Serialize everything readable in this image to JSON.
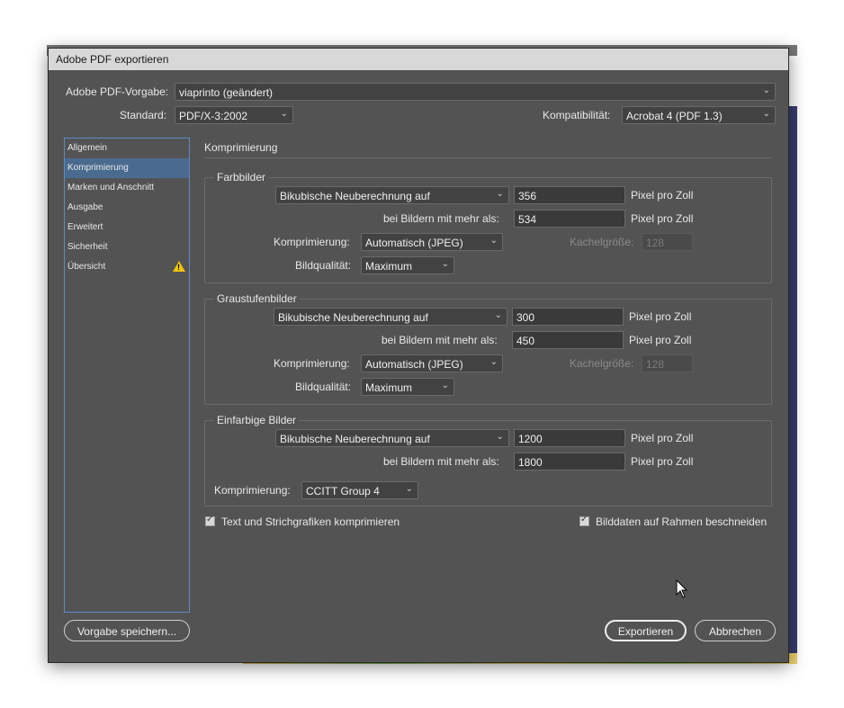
{
  "window": {
    "title": "Adobe PDF exportieren"
  },
  "header": {
    "preset_label": "Adobe PDF-Vorgabe:",
    "preset_value": "viaprinto (geändert)",
    "standard_label": "Standard:",
    "standard_value": "PDF/X-3:2002",
    "compat_label": "Kompatibilität:",
    "compat_value": "Acrobat 4 (PDF 1.3)"
  },
  "sidebar": {
    "items": [
      {
        "label": "Allgemein"
      },
      {
        "label": "Komprimierung"
      },
      {
        "label": "Marken und Anschnitt"
      },
      {
        "label": "Ausgabe"
      },
      {
        "label": "Erweitert"
      },
      {
        "label": "Sicherheit"
      },
      {
        "label": "Übersicht"
      }
    ],
    "selected": "Komprimierung"
  },
  "main": {
    "title": "Komprimierung",
    "color": {
      "title": "Farbbilder",
      "resample": "Bikubische Neuberechnung auf",
      "ppi": "356",
      "above_label": "bei Bildern mit mehr als:",
      "above": "534",
      "unit": "Pixel pro Zoll",
      "compression_label": "Komprimierung:",
      "compression": "Automatisch (JPEG)",
      "tile_label": "Kachelgröße:",
      "tile": "128",
      "quality_label": "Bildqualität:",
      "quality": "Maximum"
    },
    "gray": {
      "title": "Graustufenbilder",
      "resample": "Bikubische Neuberechnung auf",
      "ppi": "300",
      "above_label": "bei Bildern mit mehr als:",
      "above": "450",
      "unit": "Pixel pro Zoll",
      "compression_label": "Komprimierung:",
      "compression": "Automatisch (JPEG)",
      "tile_label": "Kachelgröße:",
      "tile": "128",
      "quality_label": "Bildqualität:",
      "quality": "Maximum"
    },
    "mono": {
      "title": "Einfarbige Bilder",
      "resample": "Bikubische Neuberechnung auf",
      "ppi": "1200",
      "above_label": "bei Bildern mit mehr als:",
      "above": "1800",
      "unit": "Pixel pro Zoll",
      "compression_label": "Komprimierung:",
      "compression": "CCITT Group 4"
    },
    "compress_text_label": "Text und Strichgrafiken komprimieren",
    "compress_text_checked": true,
    "crop_label": "Bilddaten auf Rahmen beschneiden",
    "crop_checked": true
  },
  "footer": {
    "save_preset": "Vorgabe speichern...",
    "export": "Exportieren",
    "cancel": "Abbrechen"
  },
  "icons": {
    "warning": "warning-icon",
    "chevron": "chevron-down-icon",
    "check": "check-icon"
  },
  "colors": {
    "dialog_bg": "#535353",
    "selection": "#4a6b8f",
    "nav_border": "#5b8bc4",
    "warning": "#f2c500"
  }
}
